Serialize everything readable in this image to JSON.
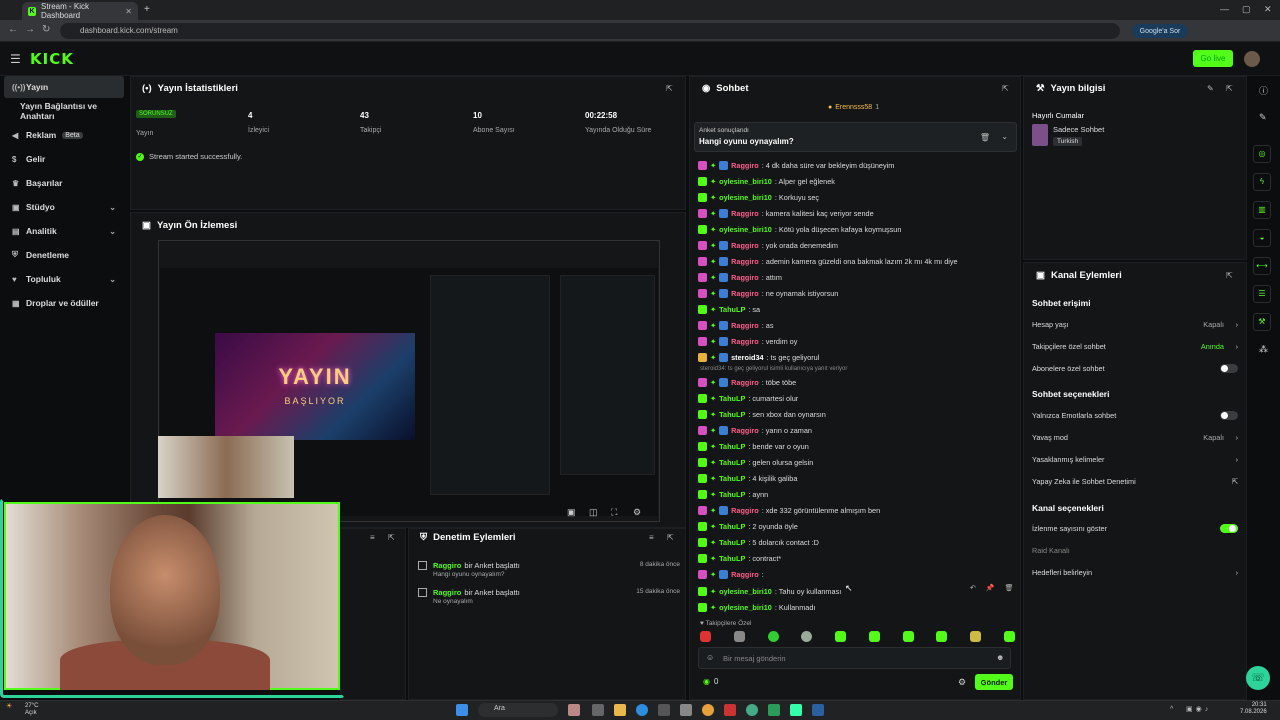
{
  "browser": {
    "tab_title": "Stream - Kick Dashboard",
    "url": "dashboard.kick.com/stream",
    "google_btn": "Google'a Sor"
  },
  "header": {
    "logo": "KICK",
    "go_live": "Go live"
  },
  "sidebar": {
    "items": [
      {
        "label": "Yayın",
        "icon": "stream-icon"
      },
      {
        "label": "Yayın Bağlantısı ve Anahtarı",
        "icon": ""
      },
      {
        "label": "Reklam",
        "badge": "Beta",
        "icon": "megaphone-icon"
      },
      {
        "label": "Gelir",
        "icon": "money-icon"
      },
      {
        "label": "Başarılar",
        "icon": "trophy-icon"
      },
      {
        "label": "Stüdyo",
        "icon": "studio-icon"
      },
      {
        "label": "Analitik",
        "icon": "chart-icon"
      },
      {
        "label": "Denetleme",
        "icon": "shield-icon"
      },
      {
        "label": "Topluluk",
        "icon": "community-icon"
      },
      {
        "label": "Droplar ve ödüller",
        "icon": "gift-icon"
      }
    ]
  },
  "stats": {
    "title": "Yayın İstatistikleri",
    "status_badge": "SORUNSUZ",
    "status_label": "Yayın",
    "viewers": "4",
    "viewers_label": "İzleyici",
    "followers": "43",
    "followers_label": "Takipçi",
    "subs": "10",
    "subs_label": "Abone Sayısı",
    "uptime": "00:22:58",
    "uptime_label": "Yayında Olduğu Süre",
    "success": "Stream started successfully."
  },
  "preview": {
    "title": "Yayın Ön İzlemesi",
    "overlay_text": "YAYIN",
    "overlay_sub": "BAŞLIYOR"
  },
  "moderation": {
    "title": "Denetim Eylemleri",
    "rows": [
      {
        "user": "Raggiro",
        "action": "bir Anket başlattı",
        "sub": "Hangi oyunu oynayalım?",
        "time": "8 dakika önce"
      },
      {
        "user": "Raggiro",
        "action": "bir Anket başlattı",
        "sub": "Ne oynayalım",
        "time": "15 dakika önce"
      }
    ]
  },
  "chat": {
    "title": "Sohbet",
    "pinned_user": "Erennsss58",
    "pinned_count": "1",
    "poll_label": "Anket sonuçlandı",
    "poll_question": "Hangi oyunu oynayalım?",
    "messages": [
      {
        "user": "Raggiro",
        "text": ": 4 dk daha süre var bekleyim düşüneyim",
        "color": "#ff5c8a"
      },
      {
        "user": "oylesine_biri10",
        "text": ": Alper gel eğlenek",
        "color": "#53fc18"
      },
      {
        "user": "oylesine_biri10",
        "text": ": Korkuyu seç",
        "color": "#53fc18"
      },
      {
        "user": "Raggiro",
        "text": ": kamera kalitesi kaç veriyor sende",
        "color": "#ff5c8a"
      },
      {
        "user": "oylesine_biri10",
        "text": ": Kötü yola düşecen kafaya koymuşsun",
        "color": "#53fc18"
      },
      {
        "user": "Raggiro",
        "text": ": yok orada denemedim",
        "color": "#ff5c8a"
      },
      {
        "user": "Raggiro",
        "text": ": ademin kamera güzeldi ona bakmak lazım 2k mı 4k mı diye",
        "color": "#ff5c8a"
      },
      {
        "user": "Raggiro",
        "text": ": attım",
        "color": "#ff5c8a"
      },
      {
        "user": "Raggiro",
        "text": ": ne oynamak istiyorsun",
        "color": "#ff5c8a"
      },
      {
        "user": "TahuLP",
        "text": ": sa",
        "color": "#53fc18"
      },
      {
        "user": "Raggiro",
        "text": ": as",
        "color": "#ff5c8a"
      },
      {
        "user": "Raggiro",
        "text": ": verdim oy",
        "color": "#ff5c8a"
      },
      {
        "user": "steroid34",
        "text": ": ts geç geliyorul",
        "color": "#ffffff"
      },
      {
        "user": "Raggiro",
        "text": ": töbe töbe",
        "color": "#ff5c8a"
      },
      {
        "user": "TahuLP",
        "text": ": cumartesi olur",
        "color": "#53fc18"
      },
      {
        "user": "TahuLP",
        "text": ": sen xbox dan oynarsın",
        "color": "#53fc18"
      },
      {
        "user": "Raggiro",
        "text": ": yarın o zaman",
        "color": "#ff5c8a"
      },
      {
        "user": "TahuLP",
        "text": ": bende var o oyun",
        "color": "#53fc18"
      },
      {
        "user": "TahuLP",
        "text": ": gelen olursa gelsin",
        "color": "#53fc18"
      },
      {
        "user": "TahuLP",
        "text": ": 4 kişilik galiba",
        "color": "#53fc18"
      },
      {
        "user": "TahuLP",
        "text": ": aynn",
        "color": "#53fc18"
      },
      {
        "user": "Raggiro",
        "text": ": xde 332 görüntülenme almışım ben",
        "color": "#ff5c8a"
      },
      {
        "user": "TahuLP",
        "text": ": 2 oyunda öyle",
        "color": "#53fc18"
      },
      {
        "user": "TahuLP",
        "text": ": 5 dolarcık contact :D",
        "color": "#53fc18"
      },
      {
        "user": "TahuLP",
        "text": ": contract*",
        "color": "#53fc18"
      },
      {
        "user": "Raggiro",
        "text": ":",
        "color": "#ff5c8a"
      },
      {
        "user": "oylesine_biri10",
        "text": ": Tahu oy kullanması",
        "color": "#53fc18"
      },
      {
        "user": "oylesine_biri10",
        "text": ": Kullanmadı",
        "color": "#53fc18"
      }
    ],
    "reply_hint": "steroid34: ts geç geliyorul isimli kullanıcıya yanıt veriyor",
    "followers_only": "Takipçilere Özel",
    "input_placeholder": "Bir mesaj gönderin",
    "viewer_count": "0",
    "send": "Gönder"
  },
  "stream_info": {
    "title": "Yayın bilgisi",
    "stream_title": "Hayırlı Cumalar",
    "category": "Sadece Sohbet",
    "tag": "Turkish"
  },
  "channel_actions": {
    "title": "Kanal Eylemleri",
    "chat_access": "Sohbet erişimi",
    "account_age": "Hesap yaşı",
    "account_age_val": "Kapalı",
    "followers_only": "Takipçilere özel sohbet",
    "followers_only_val": "Anında",
    "subs_only": "Abonelere özel sohbet",
    "chat_options": "Sohbet seçenekleri",
    "emote_only": "Yalnızca Emotlarla sohbet",
    "slow_mode": "Yavaş mod",
    "slow_mode_val": "Kapalı",
    "banned_words": "Yasaklanmış kelimeler",
    "ai_mod": "Yapay Zeka ile Sohbet Denetimi",
    "channel_options": "Kanal seçenekleri",
    "show_viewers": "İzlenme sayısını göster",
    "raid": "Raid Kanalı",
    "goals": "Hedefleri belirleyin"
  },
  "taskbar": {
    "weather_temp": "27°C",
    "weather_desc": "Açık",
    "search": "Ara",
    "time": "20:31",
    "date": "7.08.2026"
  }
}
